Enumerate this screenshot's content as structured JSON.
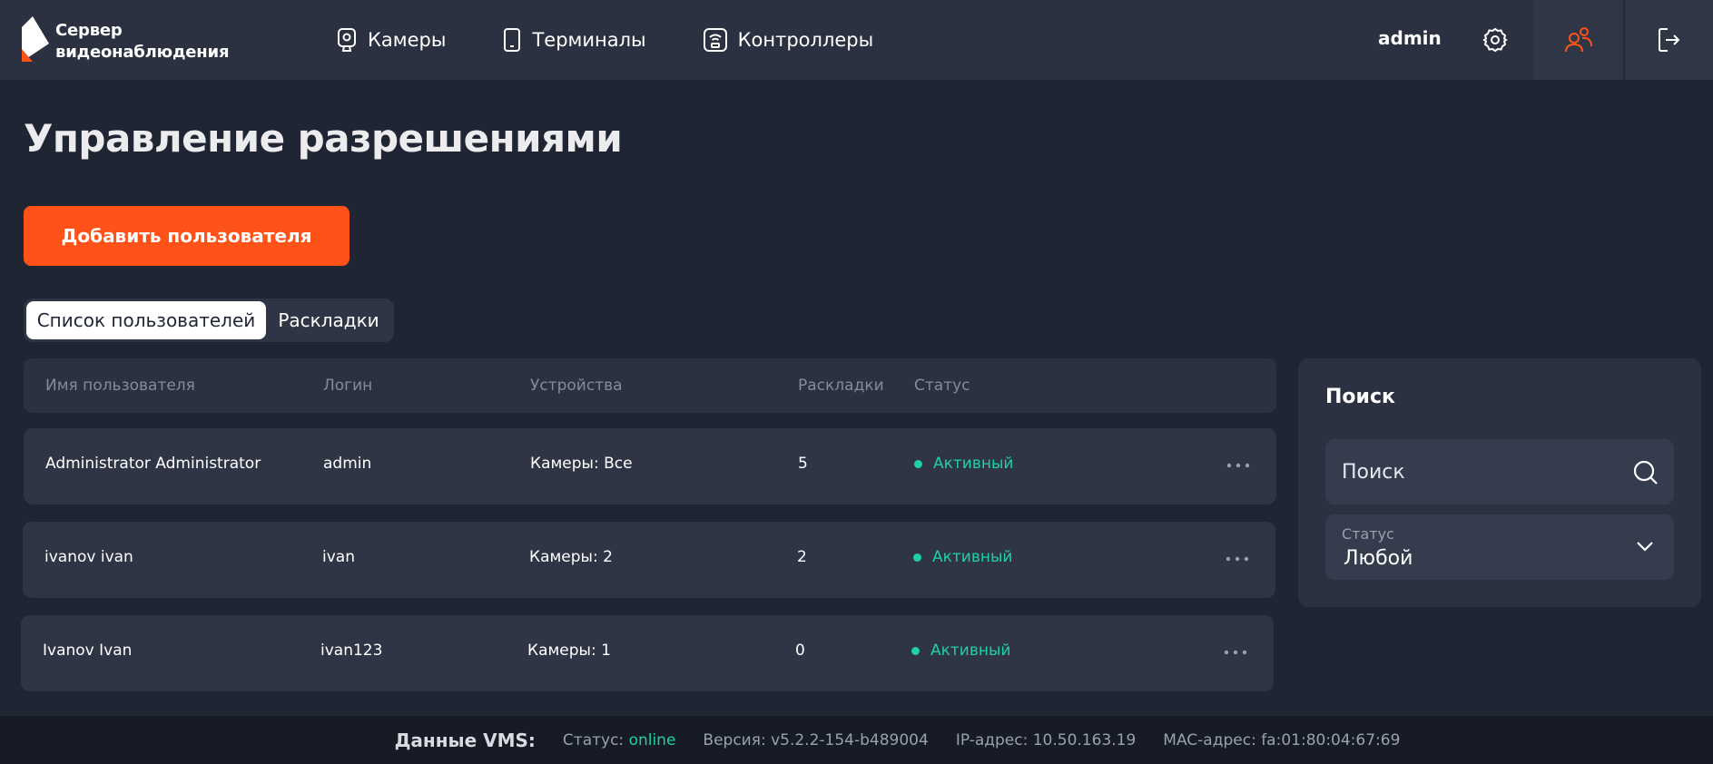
{
  "app": {
    "title_line1": "Сервер",
    "title_line2": "видеонаблюдения"
  },
  "nav": {
    "items": [
      {
        "label": "Камеры",
        "icon": "camera-icon"
      },
      {
        "label": "Терминалы",
        "icon": "tablet-icon"
      },
      {
        "label": "Контроллеры",
        "icon": "controller-icon"
      }
    ],
    "username": "admin"
  },
  "page": {
    "title": "Управление разрешениями",
    "add_user_label": "Добавить пользователя",
    "tabs": [
      {
        "label": "Список пользователей",
        "active": true
      },
      {
        "label": "Раскладки",
        "active": false
      }
    ]
  },
  "table": {
    "columns": [
      "Имя пользователя",
      "Логин",
      "Устройства",
      "Раскладки",
      "Статус"
    ],
    "rows": [
      {
        "name": "Administrator Administrator",
        "login": "admin",
        "devices": "Камеры: Все",
        "layouts": "5",
        "status": "Активный"
      },
      {
        "name": "ivanov ivan",
        "login": "ivan",
        "devices": "Камеры: 2",
        "layouts": "2",
        "status": "Активный"
      },
      {
        "name": "Ivanov Ivan",
        "login": "ivan123",
        "devices": "Камеры: 1",
        "layouts": "0",
        "status": "Активный"
      }
    ]
  },
  "search": {
    "title": "Поиск",
    "placeholder": "Поиск",
    "status_label": "Статус",
    "status_value": "Любой"
  },
  "footer": {
    "title": "Данные VMS:",
    "status_label": "Статус:",
    "status_value": "online",
    "version": "Версия: v5.2.2-154-b489004",
    "ip": "IP-адрес: 10.50.163.19",
    "mac": "MAC-адрес: fa:01:80:04:67:69"
  },
  "colors": {
    "accent": "#ff5219",
    "active_status": "#1fd1a0",
    "background": "#1f2533",
    "panel": "#2b3140"
  }
}
